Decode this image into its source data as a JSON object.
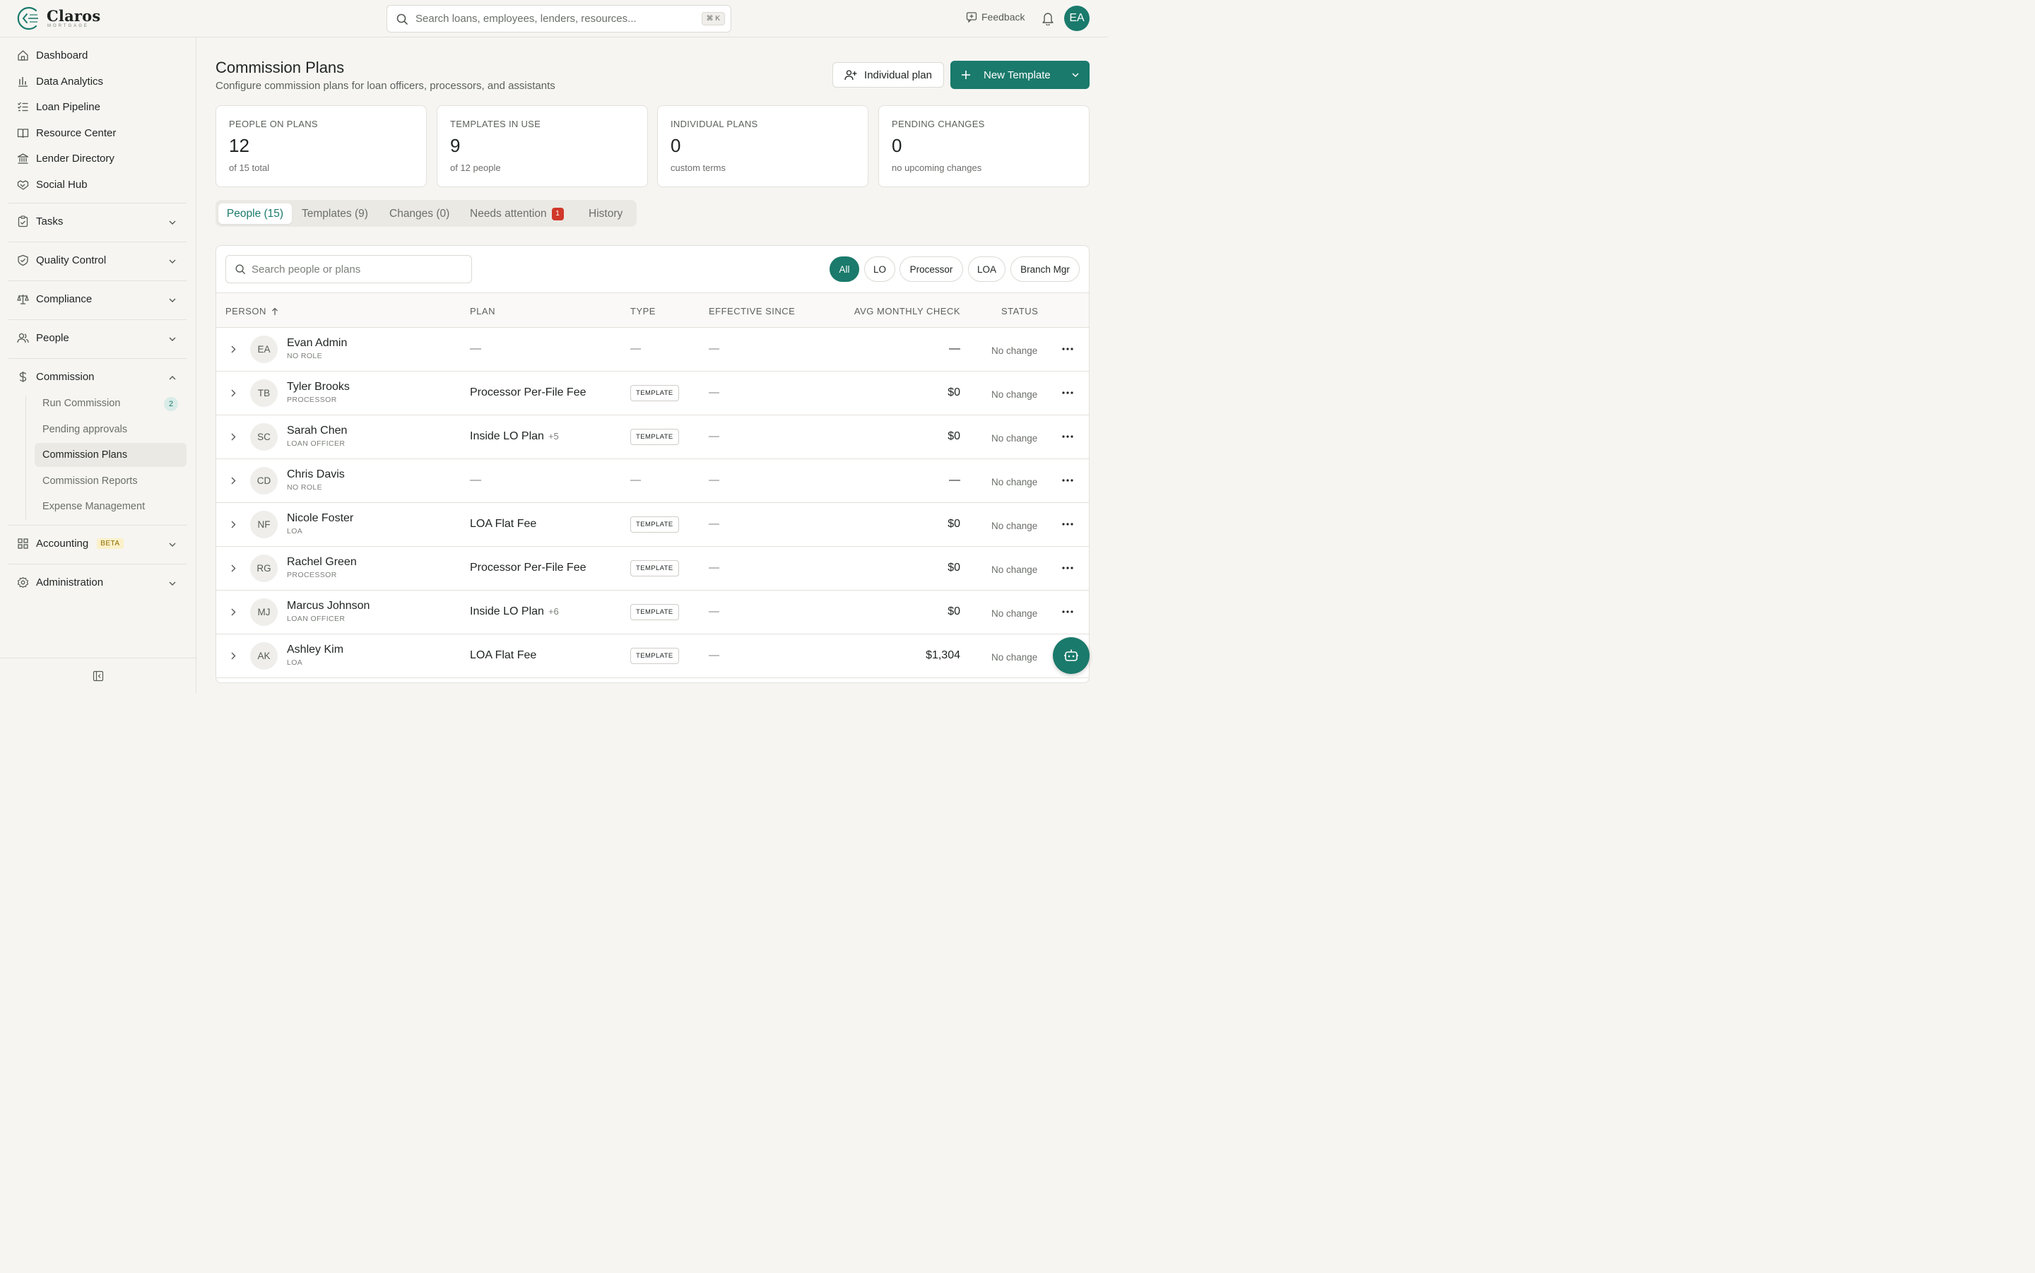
{
  "brand": {
    "name": "Claros",
    "sub": "MORTGAGE",
    "color": "#1a7a6b"
  },
  "topbar": {
    "search_placeholder": "Search loans, employees, lenders, resources...",
    "shortcut": "⌘ K",
    "feedback": "Feedback",
    "user_initials": "EA"
  },
  "sidebar": {
    "items": [
      {
        "label": "Dashboard",
        "icon": "home-icon"
      },
      {
        "label": "Data Analytics",
        "icon": "bar-chart-icon"
      },
      {
        "label": "Loan Pipeline",
        "icon": "list-check-icon"
      },
      {
        "label": "Resource Center",
        "icon": "book-icon"
      },
      {
        "label": "Lender Directory",
        "icon": "bank-icon"
      },
      {
        "label": "Social Hub",
        "icon": "handshake-icon"
      }
    ],
    "groups": [
      {
        "label": "Tasks",
        "icon": "clipboard-icon"
      },
      {
        "label": "Quality Control",
        "icon": "shield-check-icon"
      },
      {
        "label": "Compliance",
        "icon": "scale-icon"
      },
      {
        "label": "People",
        "icon": "users-icon"
      },
      {
        "label": "Commission",
        "icon": "dollar-icon"
      },
      {
        "label": "Accounting",
        "icon": "grid-icon",
        "badge": "BETA"
      },
      {
        "label": "Administration",
        "icon": "gear-icon"
      }
    ],
    "commission_sub": [
      {
        "label": "Run Commission",
        "badge": "2"
      },
      {
        "label": "Pending approvals"
      },
      {
        "label": "Commission Plans",
        "active": true
      },
      {
        "label": "Commission Reports"
      },
      {
        "label": "Expense Management"
      }
    ]
  },
  "page": {
    "title": "Commission Plans",
    "subtitle": "Configure commission plans for loan officers, processors, and assistants",
    "btn_individual": "Individual plan",
    "btn_new": "New Template"
  },
  "stats": [
    {
      "label": "PEOPLE ON PLANS",
      "value": "12",
      "note": "of 15 total"
    },
    {
      "label": "TEMPLATES IN USE",
      "value": "9",
      "note": "of 12 people"
    },
    {
      "label": "INDIVIDUAL PLANS",
      "value": "0",
      "note": "custom terms"
    },
    {
      "label": "PENDING CHANGES",
      "value": "0",
      "note": "no upcoming changes"
    }
  ],
  "tabs": [
    {
      "label": "People (15)",
      "active": true
    },
    {
      "label": "Templates (9)"
    },
    {
      "label": "Changes (0)"
    },
    {
      "label": "Needs attention",
      "badge": "1"
    },
    {
      "label": "History"
    }
  ],
  "table": {
    "search_placeholder": "Search people or plans",
    "filters": [
      "All",
      "LO",
      "Processor",
      "LOA",
      "Branch Mgr"
    ],
    "active_filter": "All",
    "columns": [
      "PERSON",
      "PLAN",
      "TYPE",
      "EFFECTIVE SINCE",
      "AVG MONTHLY CHECK",
      "STATUS"
    ],
    "sort_column": "PERSON",
    "sort_dir": "asc",
    "rows": [
      {
        "initials": "EA",
        "name": "Evan Admin",
        "role": "NO ROLE",
        "plan": "—",
        "extra": "",
        "type": "—",
        "since": "—",
        "check": "—",
        "status": "No change"
      },
      {
        "initials": "TB",
        "name": "Tyler Brooks",
        "role": "PROCESSOR",
        "plan": "Processor Per-File Fee",
        "extra": "",
        "type": "TEMPLATE",
        "since": "—",
        "check": "$0",
        "status": "No change"
      },
      {
        "initials": "SC",
        "name": "Sarah Chen",
        "role": "LOAN OFFICER",
        "plan": "Inside LO Plan",
        "extra": "+5",
        "type": "TEMPLATE",
        "since": "—",
        "check": "$0",
        "status": "No change"
      },
      {
        "initials": "CD",
        "name": "Chris Davis",
        "role": "NO ROLE",
        "plan": "—",
        "extra": "",
        "type": "—",
        "since": "—",
        "check": "—",
        "status": "No change"
      },
      {
        "initials": "NF",
        "name": "Nicole Foster",
        "role": "LOA",
        "plan": "LOA Flat Fee",
        "extra": "",
        "type": "TEMPLATE",
        "since": "—",
        "check": "$0",
        "status": "No change"
      },
      {
        "initials": "RG",
        "name": "Rachel Green",
        "role": "PROCESSOR",
        "plan": "Processor Per-File Fee",
        "extra": "",
        "type": "TEMPLATE",
        "since": "—",
        "check": "$0",
        "status": "No change"
      },
      {
        "initials": "MJ",
        "name": "Marcus Johnson",
        "role": "LOAN OFFICER",
        "plan": "Inside LO Plan",
        "extra": "+6",
        "type": "TEMPLATE",
        "since": "—",
        "check": "$0",
        "status": "No change"
      },
      {
        "initials": "AK",
        "name": "Ashley Kim",
        "role": "LOA",
        "plan": "LOA Flat Fee",
        "extra": "",
        "type": "TEMPLATE",
        "since": "—",
        "check": "$1,304",
        "status": "No change"
      }
    ]
  }
}
